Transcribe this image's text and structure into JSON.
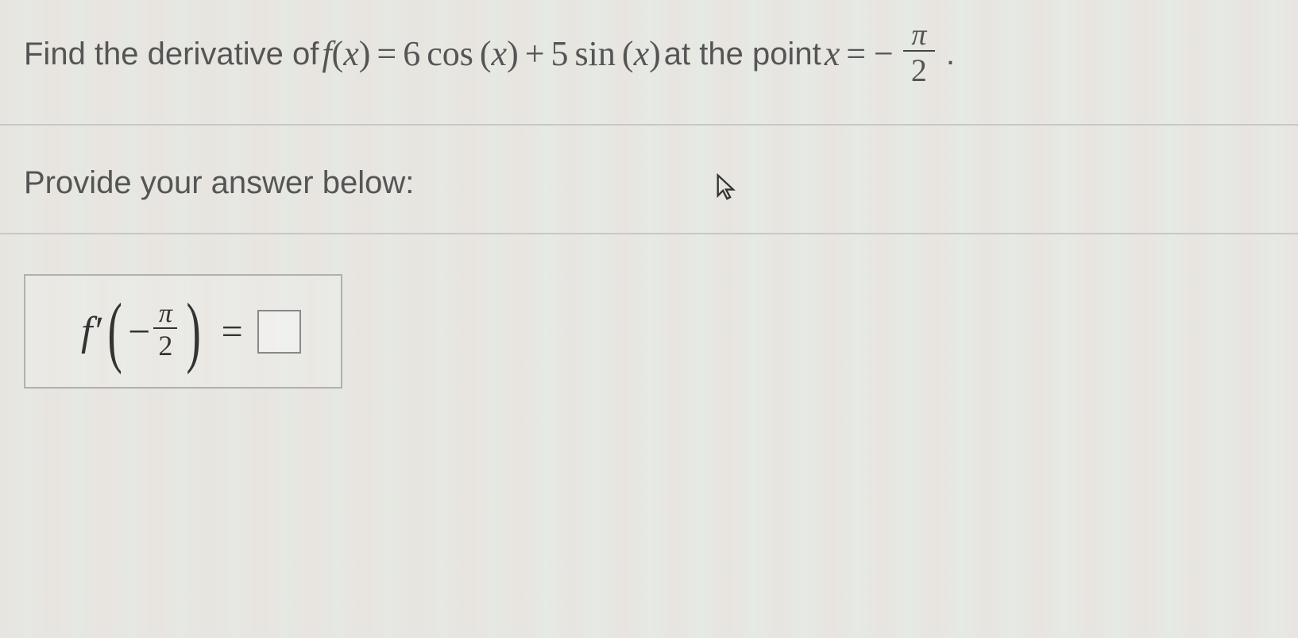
{
  "question": {
    "prefix": "Find the derivative of ",
    "func_lhs_f": "f",
    "func_lhs_paren_open": "(",
    "func_lhs_x": "x",
    "func_lhs_paren_close": ")",
    "eq1": " = ",
    "coef1": "6",
    "trig1": " cos ",
    "paren1o": "(",
    "arg1": "x",
    "paren1c": ")",
    "plus": " + ",
    "coef2": "5",
    "trig2": " sin ",
    "paren2o": "(",
    "arg2": "x",
    "paren2c": ")",
    "middle": " at the point ",
    "xvar": "x",
    "eq2": " = ",
    "neg": "−",
    "frac_num": "π",
    "frac_den": "2",
    "period": "."
  },
  "instruction": "Provide your answer below:",
  "answer": {
    "fprime": "f′",
    "paren_open": "(",
    "neg": "−",
    "frac_num": "π",
    "frac_den": "2",
    "paren_close": ")",
    "equals": "=",
    "input_value": ""
  }
}
